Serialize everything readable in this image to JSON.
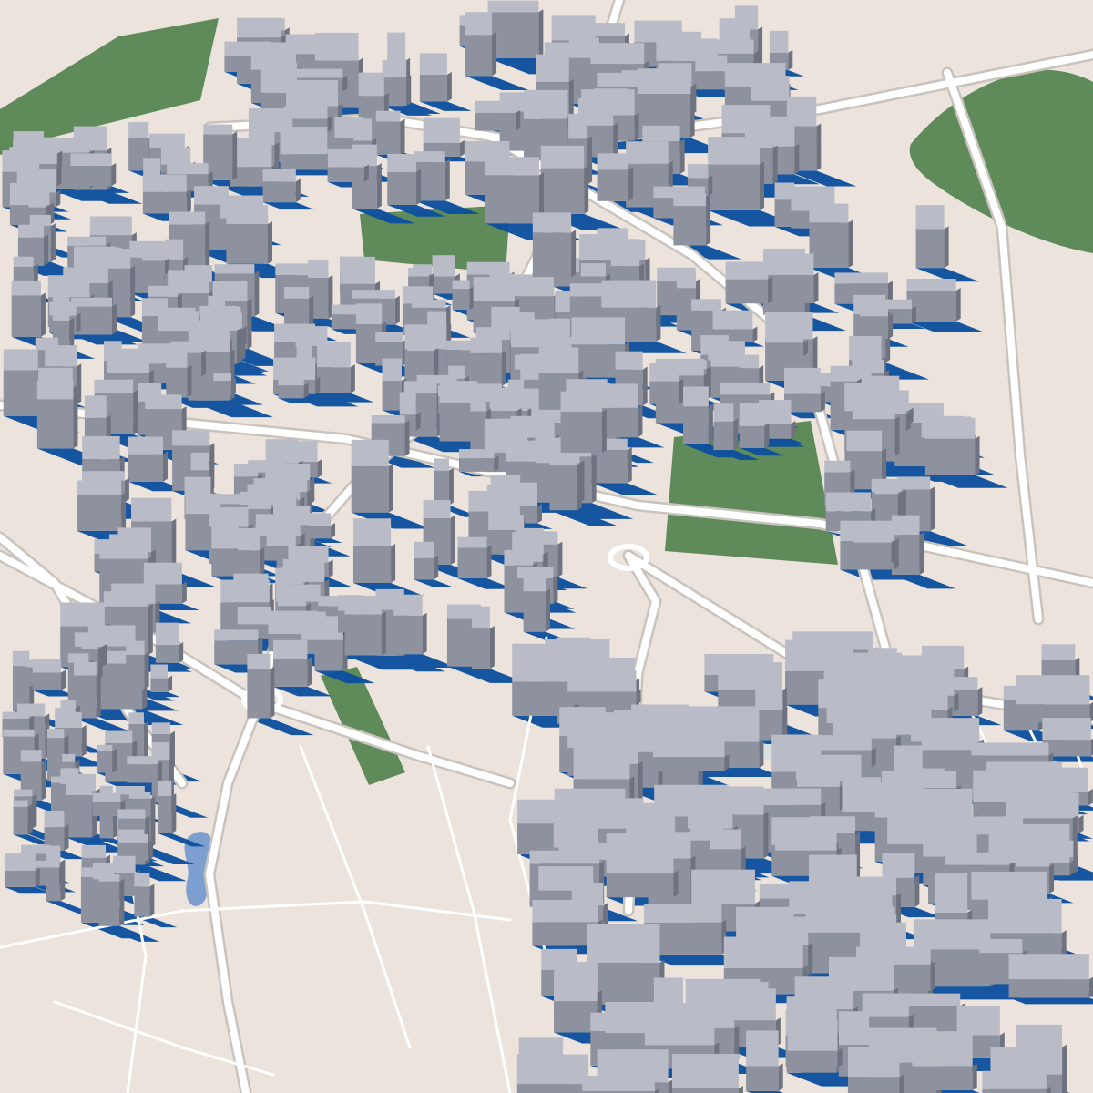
{
  "scene": {
    "kind": "3d-city-block-model",
    "projection": "oblique-aerial",
    "labels": []
  },
  "colors": {
    "ground": "#ece4dc",
    "road": "#ffffff",
    "road_edge": "#c9c3bd",
    "park": "#5f8a5a",
    "water": "#7d9fcf",
    "shadow": "#0b4f9e",
    "building_top": "#b9bcc6",
    "building_side": "#8e929e",
    "building_dark": "#6f7380",
    "plaza": "#d7e2e0"
  },
  "features": {
    "parks": [
      "park-northeast-hill",
      "park-central-north",
      "park-strip-center",
      "park-east-triangle",
      "park-northwest-edge"
    ],
    "water": [
      "pond-southwest"
    ],
    "districts": [
      "district-north",
      "district-west",
      "district-center",
      "district-east",
      "district-southeast-grid",
      "district-southwest"
    ]
  }
}
